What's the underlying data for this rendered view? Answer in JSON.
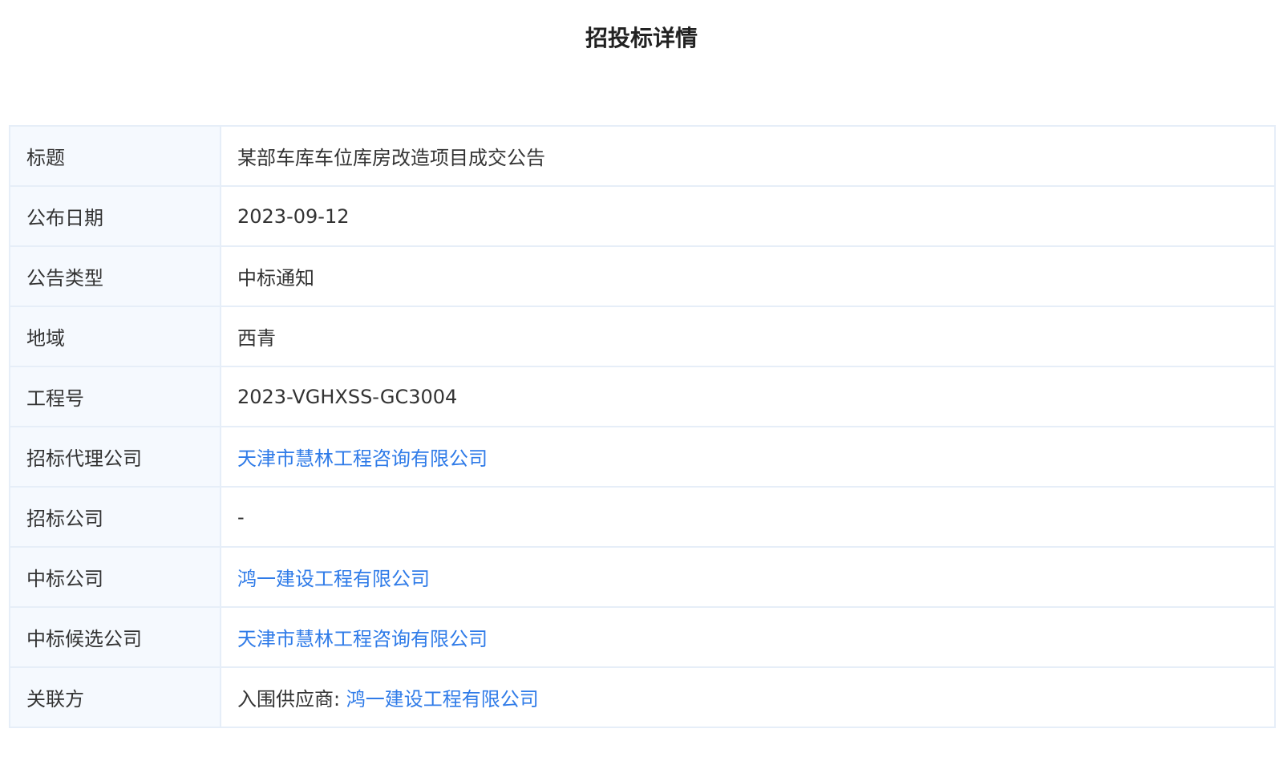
{
  "page": {
    "title": "招投标详情"
  },
  "details": {
    "title": {
      "label": "标题",
      "value": "某部车库车位库房改造项目成交公告"
    },
    "publish_date": {
      "label": "公布日期",
      "value": "2023-09-12"
    },
    "notice_type": {
      "label": "公告类型",
      "value": "中标通知"
    },
    "region": {
      "label": "地域",
      "value": "西青"
    },
    "project_no": {
      "label": "工程号",
      "value": "2023-VGHXSS-GC3004"
    },
    "agency": {
      "label": "招标代理公司",
      "value": "天津市慧林工程咨询有限公司"
    },
    "tenderer": {
      "label": "招标公司",
      "value": "-"
    },
    "winner": {
      "label": "中标公司",
      "value": "鸿一建设工程有限公司"
    },
    "candidate": {
      "label": "中标候选公司",
      "value": "天津市慧林工程咨询有限公司"
    },
    "related": {
      "label": "关联方",
      "prefix": "入围供应商: ",
      "value": "鸿一建设工程有限公司"
    }
  },
  "colors": {
    "link": "#2f7be8",
    "label_bg": "#f5f9fe",
    "border": "#e6eef8",
    "text": "#333333"
  }
}
